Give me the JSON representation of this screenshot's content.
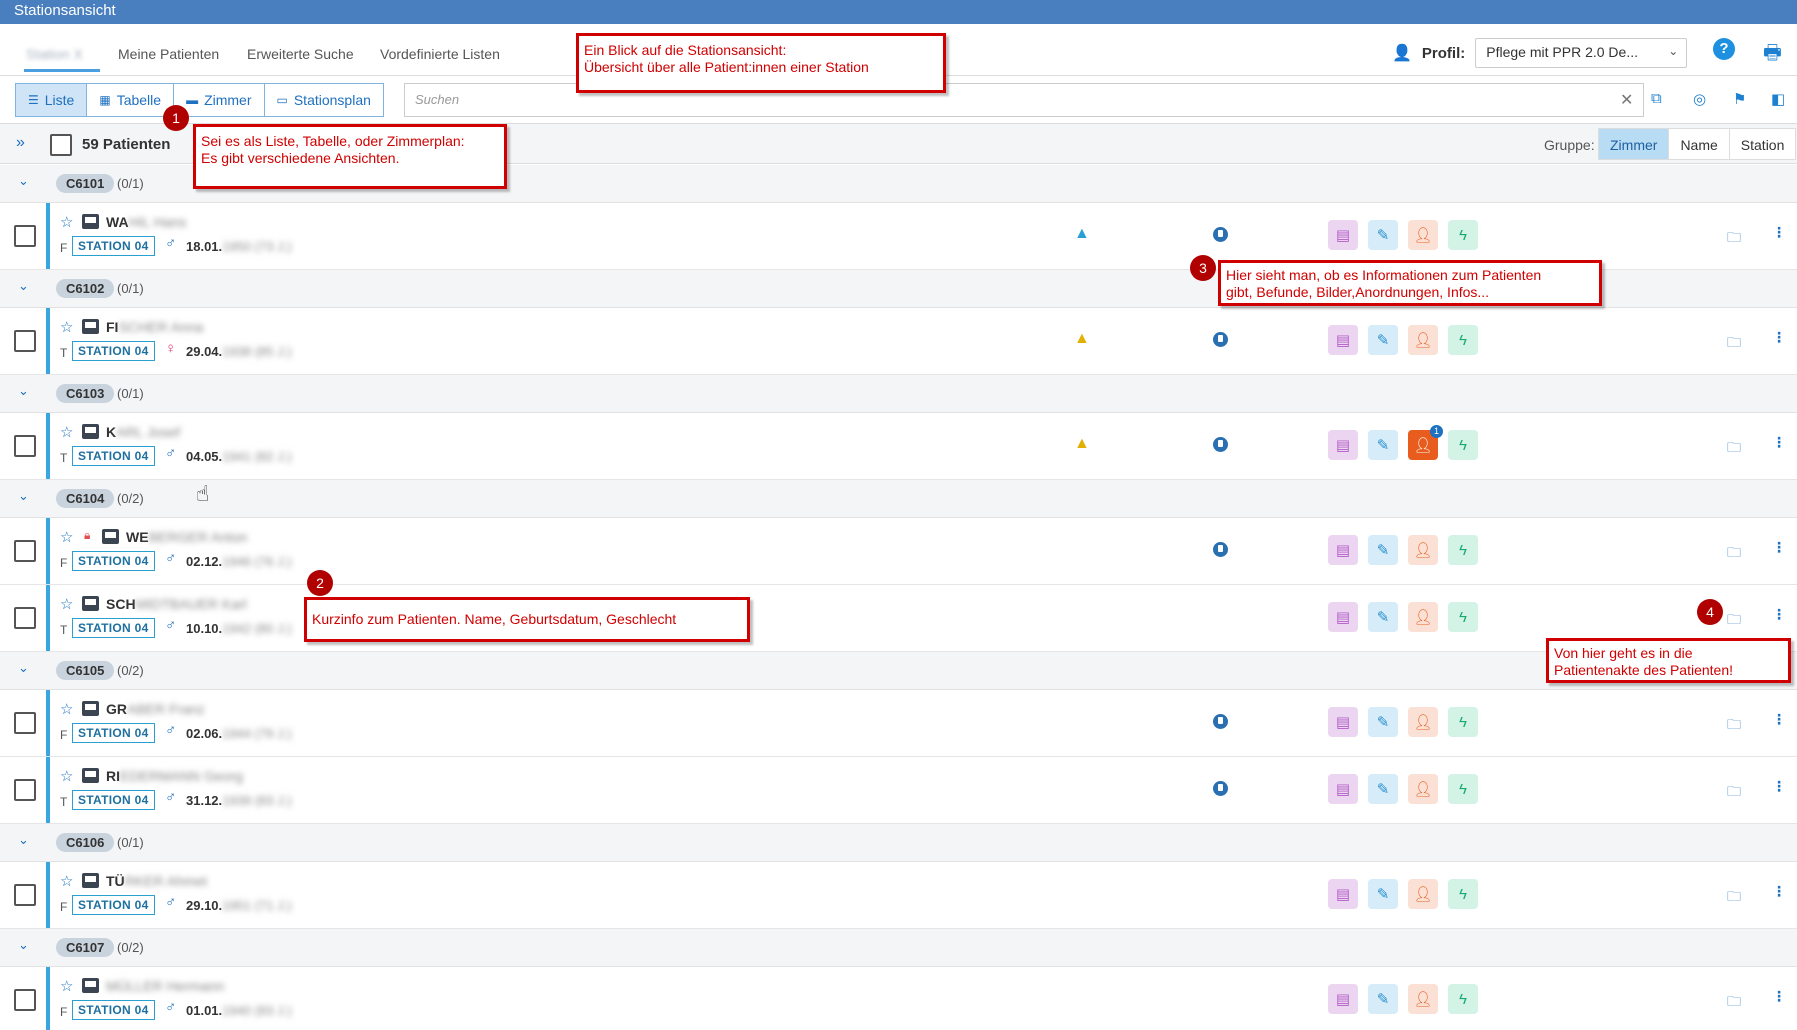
{
  "window": {
    "title": "Stationsansicht"
  },
  "nav": {
    "tabs": [
      {
        "label": "Station X"
      },
      {
        "label": "Meine Patienten"
      },
      {
        "label": "Erweiterte Suche"
      },
      {
        "label": "Vordefinierte Listen"
      }
    ],
    "profile_label": "Profil:",
    "profile_value": "Pflege mit PPR 2.0 De...",
    "help": "?"
  },
  "toolbar": {
    "views": [
      {
        "label": "Liste",
        "icon": "list-icon"
      },
      {
        "label": "Tabelle",
        "icon": "table-icon"
      },
      {
        "label": "Zimmer",
        "icon": "bed-icon"
      },
      {
        "label": "Stationsplan",
        "icon": "plan-icon"
      }
    ],
    "search_placeholder": "Suchen"
  },
  "list": {
    "count_label": "59 Patienten",
    "group_label": "Gruppe:",
    "group_options": [
      "Zimmer",
      "Name",
      "Station"
    ],
    "group_selected": "Zimmer"
  },
  "groups": [
    {
      "room": "C6101",
      "count": "(0/1)",
      "patients": [
        {
          "name_visible": "WA",
          "name_hidden": "HIL Hans",
          "type": "F",
          "station": "STATION 04",
          "sex": "♂",
          "dob_visible": "18.01.",
          "dob_hidden": "1950 (73 J.)",
          "warn": "blue",
          "info": true,
          "badge": null
        }
      ]
    },
    {
      "room": "C6102",
      "count": "(0/1)",
      "patients": [
        {
          "name_visible": "FI",
          "name_hidden": "SCHER Anna",
          "type": "T",
          "station": "STATION 04",
          "sex": "♀",
          "dob_visible": "29.04.",
          "dob_hidden": "1938 (85 J.)",
          "warn": "yellow",
          "info": true,
          "badge": null
        }
      ]
    },
    {
      "room": "C6103",
      "count": "(0/1)",
      "patients": [
        {
          "name_visible": "K",
          "name_hidden": "ARL Josef",
          "type": "T",
          "station": "STATION 04",
          "sex": "♂",
          "dob_visible": "04.05.",
          "dob_hidden": "1941 (82 J.)",
          "warn": "yellow",
          "info": true,
          "badge": "1"
        }
      ]
    },
    {
      "room": "C6104",
      "count": "(0/2)",
      "patients": [
        {
          "name_visible": "WE",
          "name_hidden": "BERGER Anton",
          "type": "F",
          "station": "STATION 04",
          "sex": "♂",
          "dob_visible": "02.12.",
          "dob_hidden": "1946 (76 J.)",
          "warn": null,
          "info": true,
          "badge": null,
          "lock": true
        },
        {
          "name_visible": "SCH",
          "name_hidden": "MIDTBAUER Karl",
          "type": "T",
          "station": "STATION 04",
          "sex": "♂",
          "dob_visible": "10.10.",
          "dob_hidden": "1942 (80 J.)",
          "warn": null,
          "info": false,
          "badge": null
        }
      ]
    },
    {
      "room": "C6105",
      "count": "(0/2)",
      "patients": [
        {
          "name_visible": "GR",
          "name_hidden": "ABER Franz",
          "type": "F",
          "station": "STATION 04",
          "sex": "♂",
          "dob_visible": "02.06.",
          "dob_hidden": "1944 (79 J.)",
          "warn": null,
          "info": true,
          "badge": null
        },
        {
          "name_visible": "RI",
          "name_hidden": "EDERMANN Georg",
          "type": "T",
          "station": "STATION 04",
          "sex": "♂",
          "dob_visible": "31.12.",
          "dob_hidden": "1939 (83 J.)",
          "warn": null,
          "info": true,
          "badge": null
        }
      ]
    },
    {
      "room": "C6106",
      "count": "(0/1)",
      "patients": [
        {
          "name_visible": "TÜ",
          "name_hidden": "RKER Ahmet",
          "type": "F",
          "station": "STATION 04",
          "sex": "♂",
          "dob_visible": "29.10.",
          "dob_hidden": "1951 (71 J.)",
          "warn": null,
          "info": false,
          "badge": null
        }
      ]
    },
    {
      "room": "C6107",
      "count": "(0/2)",
      "patients": [
        {
          "name_visible": "",
          "name_hidden": "MÜLLER Hermann",
          "type": "F",
          "station": "STATION 04",
          "sex": "♂",
          "dob_visible": "01.01.",
          "dob_hidden": "1940 (83 J.)",
          "warn": null,
          "info": false,
          "badge": null
        }
      ]
    }
  ],
  "annotations": {
    "a0": {
      "line1": "Ein Blick auf die Stationsansicht:",
      "line2": "Übersicht über alle Patient:innen einer Station"
    },
    "a1": {
      "num": "1",
      "line1": "Sei es als Liste, Tabelle, oder Zimmerplan:",
      "line2": "Es gibt verschiedene Ansichten."
    },
    "a2": {
      "num": "2",
      "line1": "Kurzinfo zum Patienten. Name, Geburtsdatum, Geschlecht"
    },
    "a3": {
      "num": "3",
      "line1": "Hier sieht man, ob es Informationen zum Patienten",
      "line2": "gibt, Befunde, Bilder,Anordnungen, Infos..."
    },
    "a4": {
      "num": "4",
      "line1": "Von hier geht es in die",
      "line2": "Patientenakte des Patienten!"
    }
  },
  "colors": {
    "accent": "#1e70c0",
    "titlebar": "#4a7fbf",
    "annotation": "#d00000"
  }
}
